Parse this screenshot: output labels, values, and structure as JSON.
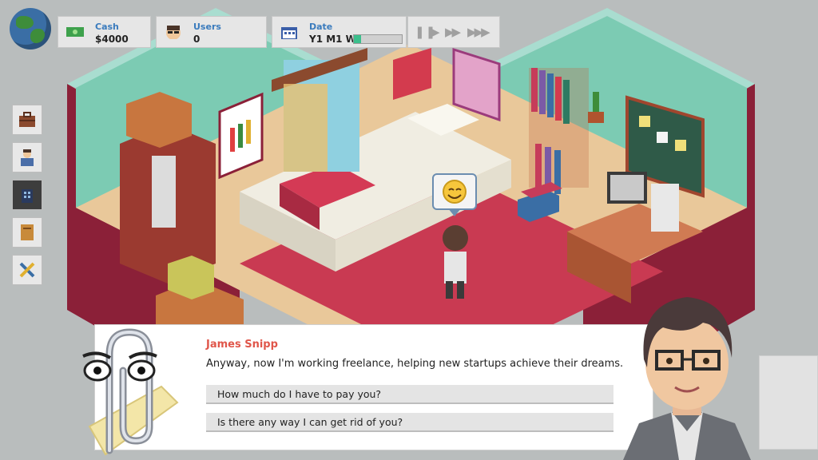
{
  "hud": {
    "cash": {
      "label": "Cash",
      "value": "$4000",
      "icon": "cash-icon"
    },
    "users": {
      "label": "Users",
      "value": "0",
      "icon": "user-face-icon"
    },
    "date": {
      "label": "Date",
      "value": "Y1 M1 W",
      "progress": 0.15,
      "icon": "calendar-icon"
    },
    "speed": {
      "pause": "pause-icon",
      "play": "play-icon",
      "fast": "fast-forward-icon",
      "fastest": "fastest-forward-icon"
    }
  },
  "toolbar": {
    "items": [
      {
        "icon": "briefcase-icon"
      },
      {
        "icon": "employee-icon"
      },
      {
        "icon": "office-building-icon",
        "active": true
      },
      {
        "icon": "notebook-icon"
      },
      {
        "icon": "tools-icon"
      }
    ]
  },
  "emotion": {
    "icon": "smiley-icon"
  },
  "dialog": {
    "speaker": "James Snipp",
    "line": "Anyway, now I'm working freelance, helping new startups achieve their dreams.",
    "choices": [
      {
        "label": "How much do I have to pay you?"
      },
      {
        "label": "Is there any way I can get rid of you?"
      }
    ]
  },
  "colors": {
    "wall": "#7ccbb3",
    "floor": "#e9c89a",
    "rug": "#c93a52",
    "accent": "#3a7bbd",
    "speaker": "#e0564a"
  }
}
